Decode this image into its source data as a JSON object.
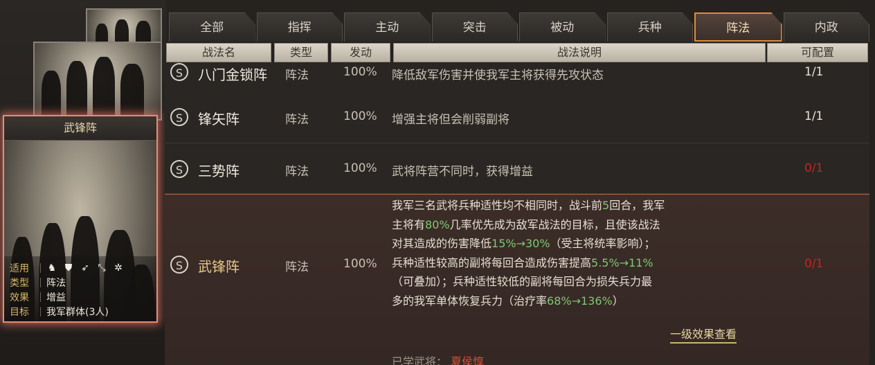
{
  "tabs": [
    {
      "label": "全部"
    },
    {
      "label": "指挥"
    },
    {
      "label": "主动"
    },
    {
      "label": "突击"
    },
    {
      "label": "被动"
    },
    {
      "label": "兵种"
    },
    {
      "label": "阵法",
      "active": true
    },
    {
      "label": "内政"
    }
  ],
  "headers": {
    "name": "战法名",
    "type": "类型",
    "rate": "发动",
    "desc": "战法说明",
    "config": "可配置"
  },
  "selected_card": {
    "title": "武锋阵",
    "rows": [
      {
        "key": "适用",
        "value": ""
      },
      {
        "key": "类型",
        "value": "阵法"
      },
      {
        "key": "效果",
        "value": "增益"
      },
      {
        "key": "目标",
        "value": "我军群体(3人)"
      }
    ],
    "unit_icons": [
      "cavalry-icon",
      "shield-icon",
      "bow-icon",
      "spear-icon",
      "chariot-icon"
    ]
  },
  "rows": [
    {
      "badge": "S",
      "name": "八门金锁阵",
      "type": "阵法",
      "rate": "100%",
      "desc": "降低敌军伤害并使我军主将获得先攻状态",
      "config": "1/1",
      "config_color": "#e9e3d6"
    },
    {
      "badge": "S",
      "name": "锋矢阵",
      "type": "阵法",
      "rate": "100%",
      "desc": "增强主将但会削弱副将",
      "config": "1/1",
      "config_color": "#e9e3d6"
    },
    {
      "badge": "S",
      "name": "三势阵",
      "type": "阵法",
      "rate": "100%",
      "desc": "武将阵营不同时，获得增益",
      "config": "0/1",
      "config_color": "#c4251f"
    }
  ],
  "expanded_row": {
    "badge": "S",
    "name": "武锋阵",
    "type": "阵法",
    "rate": "100%",
    "config": "0/1",
    "desc_lines": [
      [
        "我军三名武将兵种适性均不相同时，战斗前",
        {
          "g": "5"
        },
        "回合，我军"
      ],
      [
        "主将有",
        {
          "g": "80%"
        },
        "几率优先成为敌军战法的目标，且使该战法"
      ],
      [
        "对其造成的伤害降低",
        {
          "g": "15%→30%"
        },
        "（受主将统率影响）；"
      ],
      [
        "兵种适性较高的副将每回合造成伤害提高",
        {
          "g": "5.5%→11%"
        }
      ],
      [
        "（可叠加）；兵种适性较低的副将每回合为损失兵力最"
      ],
      [
        "多的我军单体恢复兵力（治疗率",
        {
          "g": "68%→136%"
        },
        "）"
      ]
    ],
    "more_link": "一级效果查看",
    "extra_label": "已学武将：",
    "extra_name": "夏侯惇"
  },
  "colors": {
    "active_tab_border": "#e08c3a",
    "highlight_green": "#7fc872",
    "warn_red": "#c4251f",
    "selected_glow": "#e98c74"
  }
}
